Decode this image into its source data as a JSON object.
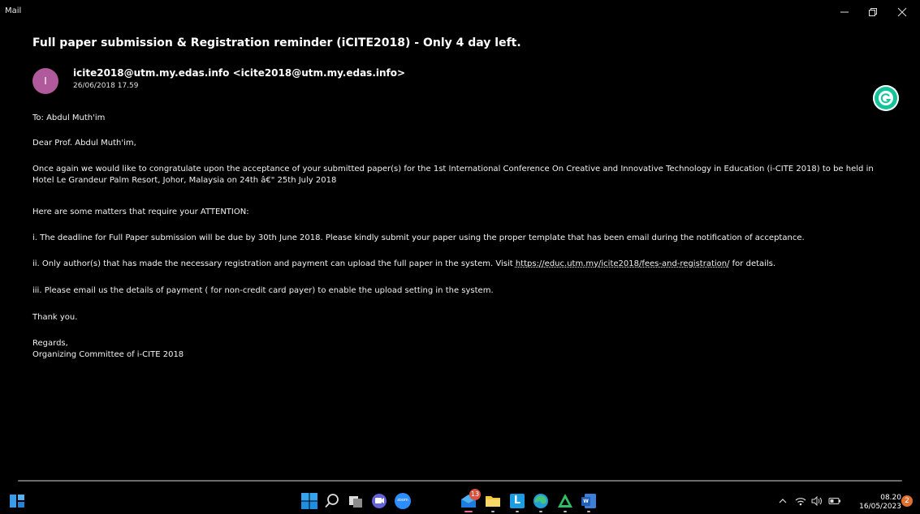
{
  "window": {
    "app_title": "Mail",
    "minimize_icon": "minimize-icon",
    "restore_icon": "restore-icon",
    "close_icon": "close-icon"
  },
  "message": {
    "subject": "Full paper submission & Registration reminder (iCITE2018) - Only 4 day left.",
    "avatar_initial": "I",
    "sender": "icite2018@utm.my.edas.info <icite2018@utm.my.edas.info>",
    "date": "26/06/2018 17.59",
    "to": "To: Abdul Muth'im",
    "greeting": "Dear Prof. Abdul Muth'im,",
    "paragraph1": "Once again we would like to congratulate upon the acceptance of your submitted paper(s) for the 1st International Conference On Creative and Innovative Technology in Education (i-CITE 2018) to be held in Hotel Le Grandeur Palm Resort, Johor, Malaysia on 24th â€\" 25th July 2018",
    "attention": "Here are some matters that require your ATTENTION:",
    "item1": "i.   The deadline for Full Paper submission will be due by 30th June 2018. Please kindly submit your paper using the proper template that has been email during the notification of acceptance.",
    "item2_before": "ii. Only author(s) that has made the necessary registration and payment can upload the full paper in the system. Visit ",
    "item2_link": "https://educ.utm.my/icite2018/fees-and-registration/",
    "item2_after": " for details.",
    "item3": "iii. Please email us the details of payment ( for non-credit card payer) to enable the upload setting in the system.",
    "thanks": "Thank you.",
    "regards": "Regards,",
    "signature": "Organizing Committee of i-CITE 2018"
  },
  "taskbar": {
    "mail_badge": "13",
    "zoom_label": "zoom",
    "lexicon_label": "L",
    "word_label": "W",
    "time": "08.20",
    "date": "16/05/2023",
    "notification_count": "2"
  },
  "colors": {
    "background": "#000000",
    "avatar": "#b05a9c",
    "grammarly": "#15c39a",
    "badge": "#d9533f"
  }
}
